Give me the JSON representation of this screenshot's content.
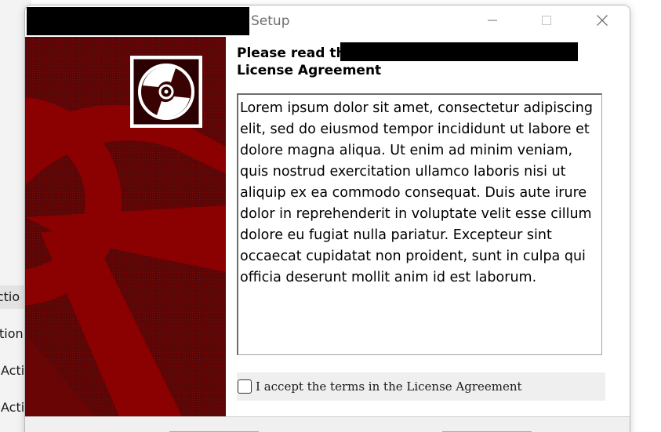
{
  "background_app": {
    "items": [
      {
        "label": "ectio",
        "active": true
      },
      {
        "label": "tion",
        "active": false
      },
      {
        "label": "Acti",
        "active": false
      },
      {
        "label": "Acti",
        "active": false
      }
    ]
  },
  "window": {
    "title": "Setup",
    "controls": {
      "minimize_icon": "minimize-icon",
      "maximize_icon": "maximize-icon",
      "close_icon": "close-icon"
    }
  },
  "banner": {
    "icon": "disc-icon",
    "color": "#8b0000"
  },
  "content": {
    "heading_line1": "Please read the",
    "heading_line2": "License Agreement",
    "license_text": "Lorem ipsum dolor sit amet, consectetur adipiscing elit, sed do eiusmod tempor incididunt ut labore et dolore magna aliqua. Ut enim ad minim veniam, quis nostrud exercitation ullamco laboris nisi ut aliquip ex ea commodo consequat. Duis aute irure dolor in reprehenderit in voluptate velit esse cillum dolore eu fugiat nulla pariatur. Excepteur sint occaecat cupidatat non proident, sunt in culpa qui officia deserunt mollit anim id est laborum.",
    "accept_label": "I accept the terms in the License Agreement",
    "accept_checked": false
  }
}
